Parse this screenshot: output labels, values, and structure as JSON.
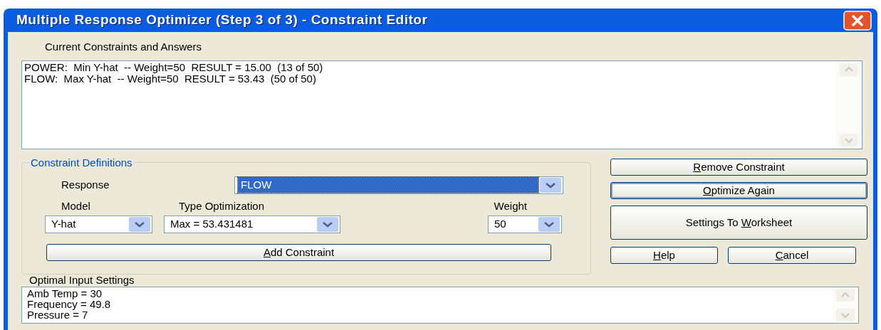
{
  "window": {
    "title": "Multiple Response Optimizer (Step 3 of 3) - Constraint Editor"
  },
  "constraints": {
    "label": "Current Constraints and Answers",
    "lines": [
      "POWER:  Min Y-hat  -- Weight=50  RESULT = 15.00  (13 of 50)",
      "FLOW:  Max Y-hat  -- Weight=50  RESULT = 53.43  (50 of 50)"
    ]
  },
  "definitions": {
    "legend": "Constraint Definitions",
    "response_label": "Response",
    "response_value": "FLOW",
    "model_label": "Model",
    "model_value": "Y-hat",
    "type_label": "Type Optimization",
    "type_value": "Max = 53.431481",
    "weight_label": "Weight",
    "weight_value": "50",
    "add_button": {
      "mnemonic": "A",
      "after": "dd Constraint"
    }
  },
  "buttons": [
    {
      "mnemonic": "R",
      "after": "emove Constraint",
      "focused": false
    },
    {
      "mnemonic": "O",
      "after": "ptimize Again",
      "focused": true
    },
    {
      "before": "Settings To ",
      "mnemonic": "W",
      "after": "orksheet",
      "focused": false
    }
  ],
  "help_button": {
    "mnemonic": "H",
    "after": "elp"
  },
  "cancel_button": {
    "mnemonic": "C",
    "after": "ancel"
  },
  "settings": {
    "label": "Optimal Input Settings",
    "lines": [
      "Amb Temp = 30",
      "Frequency = 49.8",
      "Pressure = 7"
    ]
  }
}
